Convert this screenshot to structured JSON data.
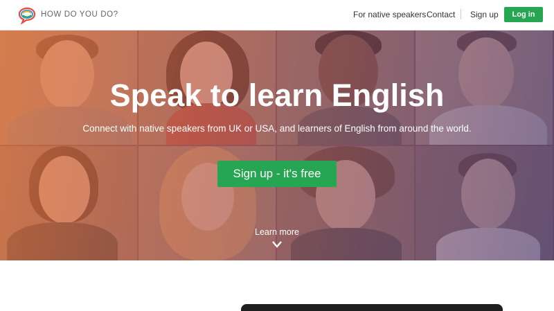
{
  "nav": {
    "brand": "HOW DO YOU DO?",
    "links": [
      "For native speakers",
      "Contact",
      "Sign up"
    ],
    "login": "Log in"
  },
  "hero": {
    "title": "Speak to learn English",
    "subtitle": "Connect with native speakers from UK or USA, and learners of English from around the world.",
    "cta": "Sign up - it's free",
    "learn_more": "Learn more"
  },
  "colors": {
    "accent": "#26a552",
    "overlay_left": "#e8783e",
    "overlay_right": "#5a4678"
  },
  "icons": [
    "speech-bubble-logo-icon",
    "chevron-down-icon"
  ]
}
